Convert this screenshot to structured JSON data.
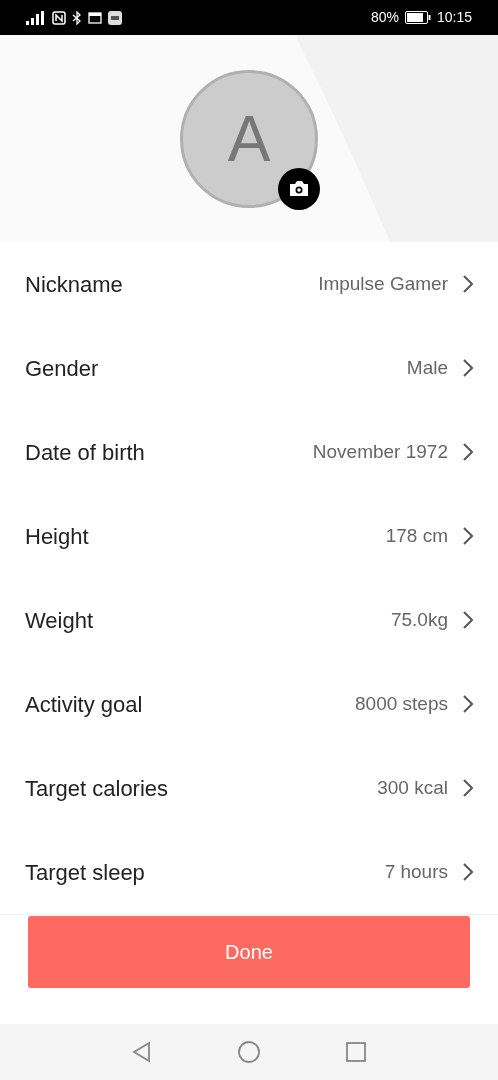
{
  "status_bar": {
    "battery_text": "80%",
    "time": "10:15"
  },
  "avatar": {
    "initial": "A"
  },
  "fields": [
    {
      "label": "Nickname",
      "value": "Impulse Gamer"
    },
    {
      "label": "Gender",
      "value": "Male"
    },
    {
      "label": "Date of birth",
      "value": "November 1972"
    },
    {
      "label": "Height",
      "value": "178 cm"
    },
    {
      "label": "Weight",
      "value": "75.0kg"
    },
    {
      "label": "Activity goal",
      "value": "8000 steps"
    },
    {
      "label": "Target calories",
      "value": "300 kcal"
    },
    {
      "label": "Target sleep",
      "value": "7 hours"
    }
  ],
  "done_button": {
    "label": "Done"
  }
}
